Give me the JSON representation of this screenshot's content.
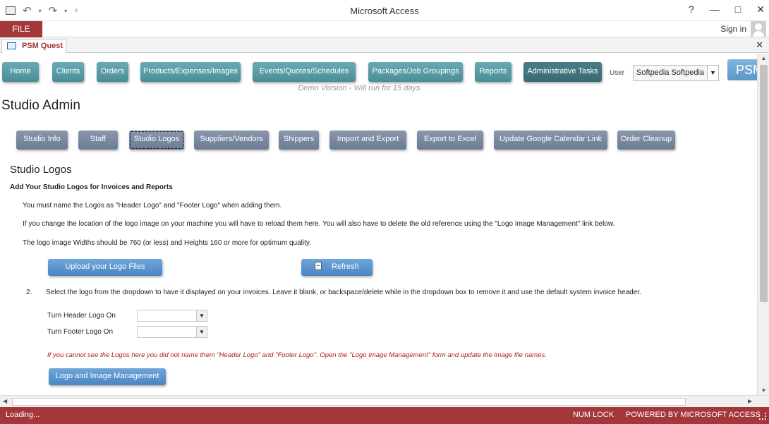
{
  "window": {
    "title": "Microsoft Access",
    "help": "?",
    "minimize": "—",
    "maximize": "□",
    "close": "✕"
  },
  "ribbon": {
    "file_tab": "FILE",
    "sign_in": "Sign in"
  },
  "doc_tab": {
    "label": "PSM Quest",
    "close": "✕"
  },
  "nav": {
    "items": [
      "Home",
      "Clients",
      "Orders",
      "Products/Expenses/Images",
      "Events/Quotes/Schedules",
      "Packages/Job Groupings",
      "Reports",
      "Administrative Tasks"
    ],
    "user_label": "User",
    "user_value": "Softpedia Softpedia",
    "psm_label": "PSM"
  },
  "demo_notice": "Demo Version - Will run for 15 days",
  "page_title": "Studio Admin",
  "subnav": {
    "items": [
      "Studio Info",
      "Staff",
      "Studio Logos",
      "Suppliers/Vendors",
      "Shippers",
      "Import and Export",
      "Export to Excel",
      "Update Google Calendar Link",
      "Order Cleanup"
    ],
    "active": "Studio Logos"
  },
  "section": {
    "title": "Studio Logos",
    "subtitle": "Add Your Studio Logos for Invoices and Reports",
    "para1": "You must name the Logos as \"Header Logo\" and \"Footer Logo\" when adding them.",
    "para2": "If you change the location of the logo image on your machine you will have to reload them here.  You will also have to delete the old reference using the \"Logo Image Management\" link below.",
    "para3": "The logo image Widths should be 760 (or less) and Heights 160 or more for optimum quality.",
    "upload_button": "Upload your Logo Files",
    "refresh_button": "Refresh",
    "step_number": "2.",
    "step_text": "Select the logo from the dropdown to have it displayed on your invoices.  Leave it blank, or backspace/delete while in the dropdown box to remove it and use the default system invoice header.",
    "header_logo_label": "Turn Header Logo On",
    "footer_logo_label": "Turn Footer Logo On",
    "header_logo_value": "",
    "footer_logo_value": "",
    "warning": "If you cannot see the Logos here you did not name them \"Header Logo\" and \"Footer Logo\". Open the \"Logo Image Management\" form and update the image file names.",
    "management_button": "Logo and Image Management"
  },
  "status": {
    "left": "Loading...",
    "num_lock": "NUM LOCK",
    "powered_by": "POWERED BY MICROSOFT ACCESS"
  },
  "colors": {
    "accent": "#a4373a",
    "nav_button": "#4a8e99",
    "sub_button": "#6b7b93",
    "blue_button": "#4a86c4",
    "warning_text": "#b01818"
  }
}
